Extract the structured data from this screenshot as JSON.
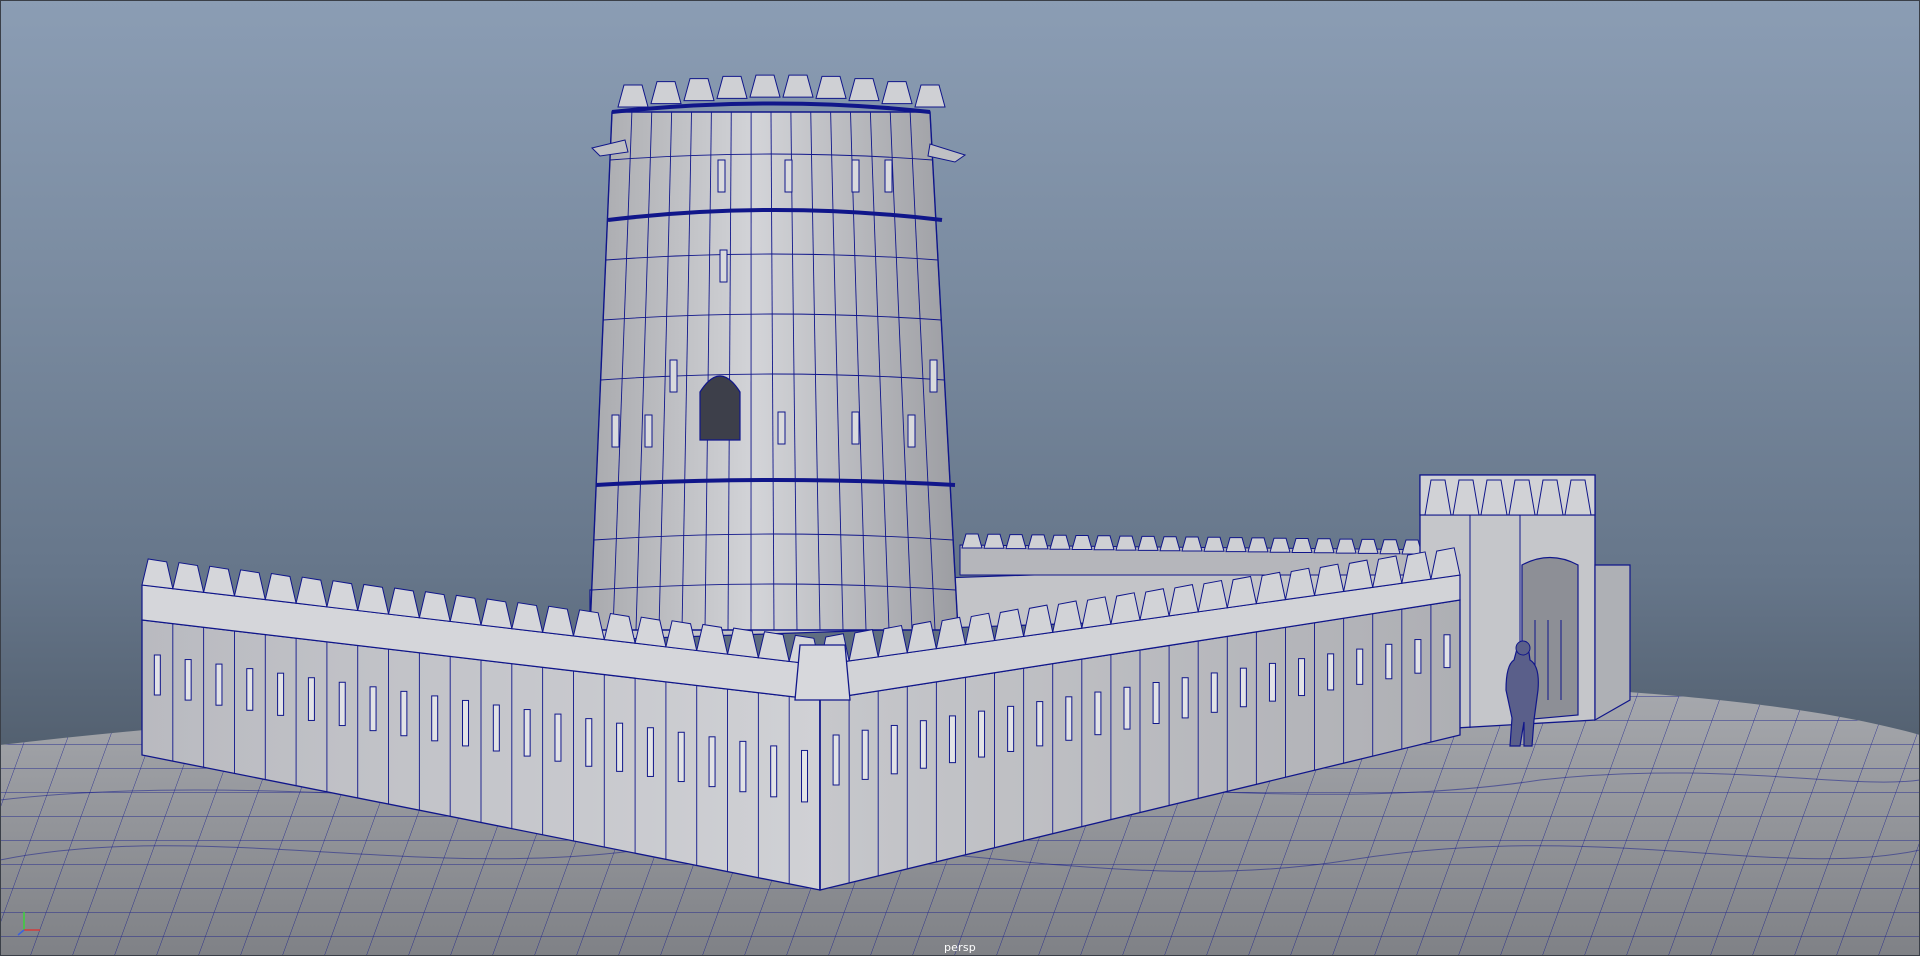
{
  "viewport": {
    "camera_name": "persp",
    "background_top": "#8b9db4",
    "background_bottom": "#454f5c",
    "wire_color": "#10168a",
    "mesh_color": "#c8c9cd",
    "ground_color": "#9a9ca2"
  },
  "axis_gizmo": {
    "x_color": "#d43a3a",
    "y_color": "#3ad43a",
    "z_color": "#3a60e0"
  }
}
